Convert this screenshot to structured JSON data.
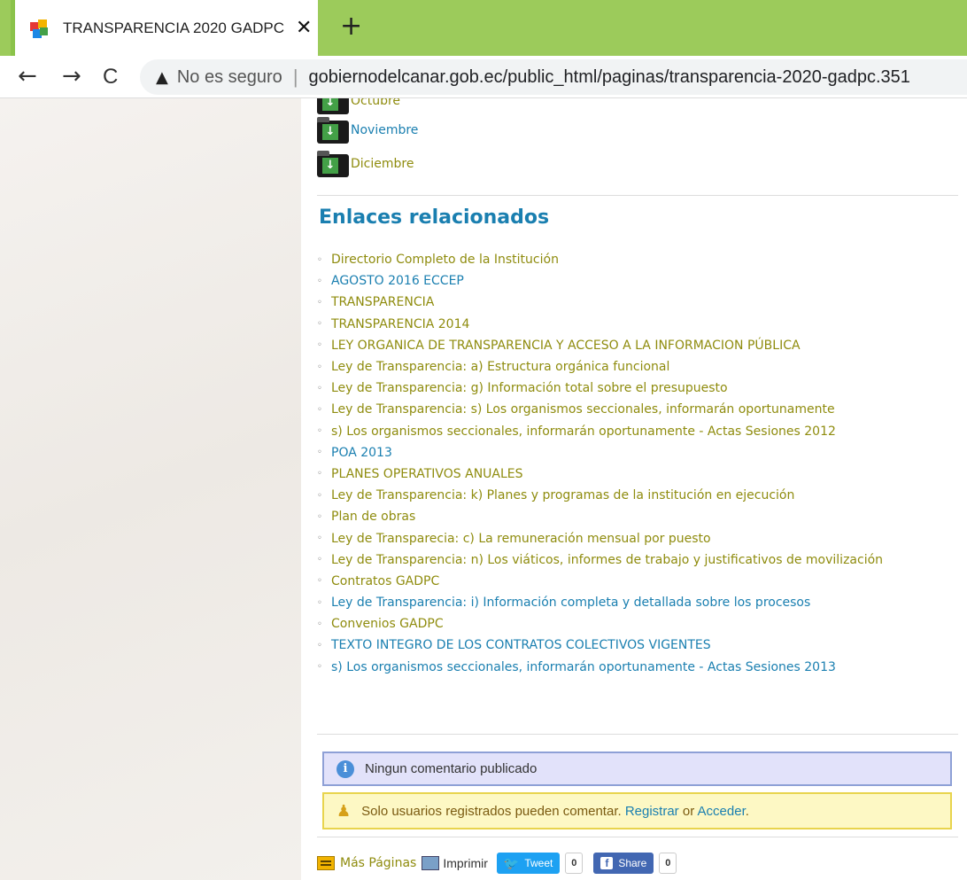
{
  "browser": {
    "tab_title": "TRANSPARENCIA 2020 GADPC ::",
    "tab_close": "✕",
    "new_tab": "+",
    "back": "←",
    "forward": "→",
    "reload": "C",
    "security_label": "No es seguro",
    "url": "gobiernodelcanar.gob.ec/public_html/paginas/transparencia-2020-gadpc.351"
  },
  "months": [
    {
      "label": "Octubre",
      "color": "olive"
    },
    {
      "label": "Noviembre",
      "color": "blue"
    },
    {
      "label": "Diciembre",
      "color": "olive"
    }
  ],
  "related": {
    "title": "Enlaces relacionados",
    "links": [
      {
        "label": "Directorio Completo de la Institución",
        "color": "olive"
      },
      {
        "label": "AGOSTO 2016 ECCEP",
        "color": "blue"
      },
      {
        "label": "TRANSPARENCIA",
        "color": "olive"
      },
      {
        "label": "TRANSPARENCIA 2014",
        "color": "olive"
      },
      {
        "label": "LEY ORGANICA DE TRANSPARENCIA Y ACCESO A LA INFORMACION PÚBLICA",
        "color": "olive"
      },
      {
        "label": "Ley de Transparencia: a) Estructura orgánica funcional",
        "color": "olive"
      },
      {
        "label": "Ley de Transparencia: g) Información total sobre el presupuesto",
        "color": "olive"
      },
      {
        "label": "Ley de Transparencia: s) Los organismos seccionales, informarán oportunamente",
        "color": "olive"
      },
      {
        "label": "s) Los organismos seccionales, informarán oportunamente - Actas Sesiones 2012",
        "color": "olive"
      },
      {
        "label": "POA 2013",
        "color": "blue"
      },
      {
        "label": "PLANES OPERATIVOS ANUALES",
        "color": "olive"
      },
      {
        "label": "Ley de Transparencia: k) Planes y programas de la institución en ejecución",
        "color": "olive"
      },
      {
        "label": "Plan de obras",
        "color": "olive"
      },
      {
        "label": "Ley de Transparecia: c) La remuneración mensual por puesto",
        "color": "olive"
      },
      {
        "label": "Ley de Transparencia: n) Los viáticos, informes de trabajo y justificativos de movilización",
        "color": "olive"
      },
      {
        "label": "Contratos GADPC",
        "color": "olive"
      },
      {
        "label": "Ley de Transparencia: i) Información completa y detallada sobre los procesos",
        "color": "blue"
      },
      {
        "label": "Convenios GADPC",
        "color": "olive"
      },
      {
        "label": "TEXTO INTEGRO DE LOS CONTRATOS COLECTIVOS VIGENTES",
        "color": "blue"
      },
      {
        "label": "s) Los organismos seccionales, informarán oportunamente - Actas Sesiones 2013",
        "color": "blue"
      }
    ]
  },
  "comments": {
    "info": "Ningun comentario publicado",
    "warn_prefix": "Solo usuarios registrados pueden comentar.",
    "register": "Registrar",
    "or": "or",
    "login": "Acceder",
    "period": "."
  },
  "footer": {
    "more_pages": "Más Páginas",
    "print": "Imprimir",
    "tweet": "Tweet",
    "tweet_count": "0",
    "share": "Share",
    "share_count": "0"
  },
  "colors": {
    "olive": "#8f8c0e",
    "blue": "#1a7fb0",
    "tabbar": "#9ccb5b"
  }
}
